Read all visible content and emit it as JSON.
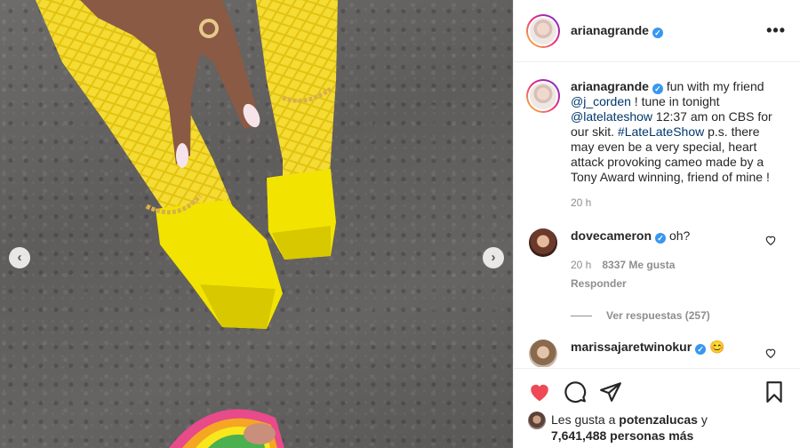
{
  "post": {
    "author": "arianagrande",
    "caption_parts": [
      " fun with my friend ",
      "@j_corden",
      " ! tune in tonight ",
      "@latelateshow",
      " 12:37 am on CBS for our skit. ",
      "#LateLateShow",
      " p.s. there may even be a very special, heart attack provoking cameo made by a Tony Award winning, friend of mine !"
    ],
    "caption_time": "20 h"
  },
  "header": {
    "username": "arianagrande",
    "more_icon": "more-horizontal-icon"
  },
  "comments": [
    {
      "username": "dovecameron",
      "text": "oh?",
      "time": "20 h",
      "likes": "8337 Me gusta",
      "reply": "Responder",
      "view_replies": "Ver respuestas (257)"
    },
    {
      "username": "marissajaretwinokur",
      "text": "😊"
    }
  ],
  "actions": {
    "like_icon": "heart-filled-icon",
    "comment_icon": "comment-icon",
    "share_icon": "share-icon",
    "save_icon": "bookmark-icon",
    "liked_color": "#ed4956"
  },
  "likes": {
    "prefix": "Les gusta a ",
    "user": "potenzalucas",
    "middle": " y",
    "count": "7,641,488 personas más"
  },
  "media": {
    "prev_icon": "‹",
    "next_icon": "›"
  }
}
